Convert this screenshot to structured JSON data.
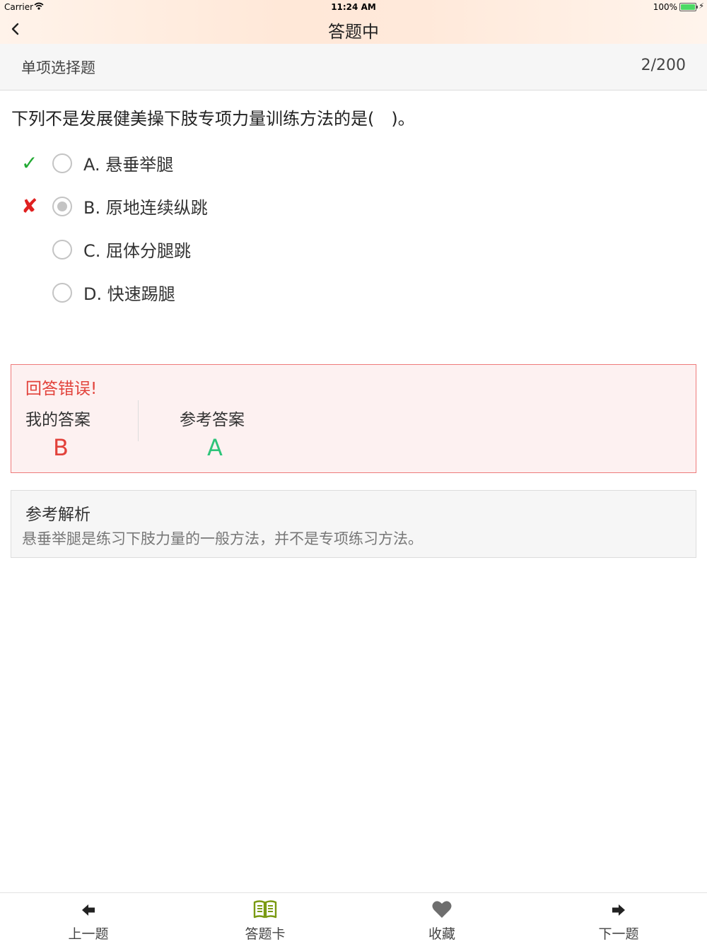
{
  "status_bar": {
    "carrier": "Carrier",
    "time": "11:24 AM",
    "battery": "100%"
  },
  "nav": {
    "title": "答题中",
    "back_icon": "chevron-left-icon"
  },
  "subheader": {
    "type": "单项选择题",
    "progress": "2/200"
  },
  "question": {
    "text": "下列不是发展健美操下肢专项力量训练方法的是(　)。",
    "options": [
      {
        "label": "A. 悬垂举腿",
        "mark": "✓",
        "status": "correct",
        "selected": false
      },
      {
        "label": "B. 原地连续纵跳",
        "mark": "✘",
        "status": "wrong",
        "selected": true
      },
      {
        "label": "C. 屈体分腿跳",
        "mark": "",
        "status": "none",
        "selected": false
      },
      {
        "label": "D. 快速踢腿",
        "mark": "",
        "status": "none",
        "selected": false
      }
    ]
  },
  "result": {
    "title": "回答错误!",
    "my_answer_label": "我的答案",
    "my_answer": "B",
    "ref_answer_label": "参考答案",
    "ref_answer": "A",
    "colors": {
      "wrong": "#e2423b",
      "correct": "#2ec47a"
    }
  },
  "analysis": {
    "title": "参考解析",
    "text": "悬垂举腿是练习下肢力量的一般方法，并不是专项练习方法。"
  },
  "tabbar": {
    "items": [
      {
        "label": "上一题",
        "icon": "arrow-left-icon"
      },
      {
        "label": "答题卡",
        "icon": "book-icon"
      },
      {
        "label": "收藏",
        "icon": "heart-icon"
      },
      {
        "label": "下一题",
        "icon": "arrow-right-icon"
      }
    ]
  }
}
